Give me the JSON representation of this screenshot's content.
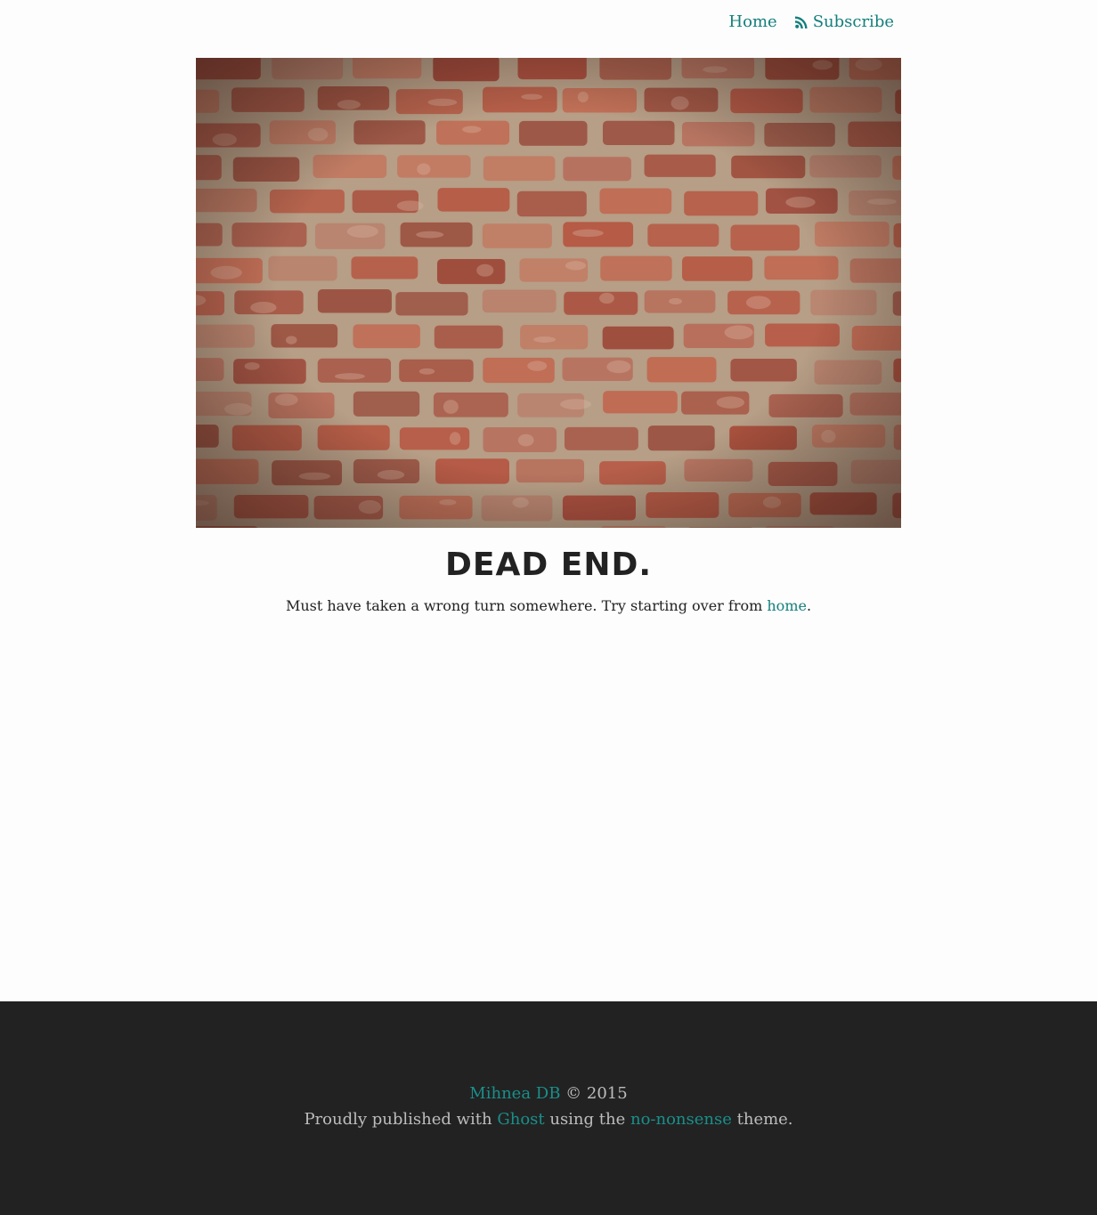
{
  "nav": {
    "home_label": "Home",
    "subscribe_label": "Subscribe",
    "subscribe_icon": "rss-icon"
  },
  "hero": {
    "image": "brick-wall-photo"
  },
  "error": {
    "title": "DEAD END.",
    "message_before": "Must have taken a wrong turn somewhere. Try starting over from ",
    "home_link": "home",
    "message_after": "."
  },
  "footer": {
    "author": "Mihnea DB",
    "copyright": " © 2015",
    "published_prefix": "Proudly published with ",
    "ghost_link": "Ghost",
    "using_text": " using the ",
    "theme_link": "no-nonsense",
    "theme_suffix": " theme."
  },
  "colors": {
    "link": "#137f7c",
    "footer_bg": "#222222",
    "footer_text": "#bdbdbd",
    "brick": "#b65a45",
    "mortar": "#b19a83"
  }
}
